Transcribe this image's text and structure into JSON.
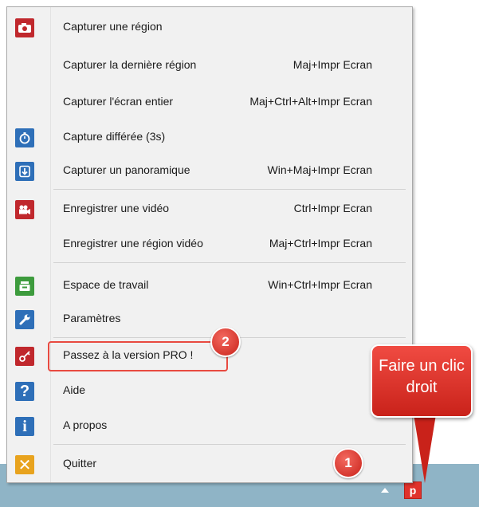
{
  "menu": {
    "items": [
      {
        "label": "Capturer une région",
        "shortcut": "",
        "icon": "camera-icon",
        "color": "#c0282d"
      },
      {
        "label": "Capturer la dernière région",
        "shortcut": "Maj+Impr Ecran",
        "icon": "",
        "color": ""
      },
      {
        "label": "Capturer l'écran entier",
        "shortcut": "Maj+Ctrl+Alt+Impr Ecran",
        "icon": "",
        "color": ""
      },
      {
        "label": "Capture différée (3s)",
        "shortcut": "",
        "icon": "timer-icon",
        "color": "#2e6fb8"
      },
      {
        "label": "Capturer un panoramique",
        "shortcut": "Win+Maj+Impr Ecran",
        "icon": "scroll-capture-icon",
        "color": "#2e6fb8"
      },
      {
        "label": "Enregistrer une vidéo",
        "shortcut": "Ctrl+Impr Ecran",
        "icon": "video-camera-icon",
        "color": "#c0282d"
      },
      {
        "label": "Enregistrer une région vidéo",
        "shortcut": "Maj+Ctrl+Impr Ecran",
        "icon": "",
        "color": ""
      },
      {
        "label": "Espace de travail",
        "shortcut": "Win+Ctrl+Impr Ecran",
        "icon": "workspace-icon",
        "color": "#3d9b3d"
      },
      {
        "label": "Paramètres",
        "shortcut": "",
        "icon": "wrench-icon",
        "color": "#2e6fb8"
      },
      {
        "label": "Passez à la version PRO !",
        "shortcut": "",
        "icon": "key-icon",
        "color": "#c0282d"
      },
      {
        "label": "Aide",
        "shortcut": "",
        "icon": "help-icon",
        "color": "#2e6fb8"
      },
      {
        "label": "A propos",
        "shortcut": "",
        "icon": "info-icon",
        "color": "#2e6fb8"
      },
      {
        "label": "Quitter",
        "shortcut": "",
        "icon": "close-icon",
        "color": "#e8a31e"
      }
    ]
  },
  "annotations": {
    "badge_1": "1",
    "badge_2": "2",
    "callout_text": "Faire un clic droit"
  },
  "taskbar": {
    "tray_app_icon": "p"
  }
}
